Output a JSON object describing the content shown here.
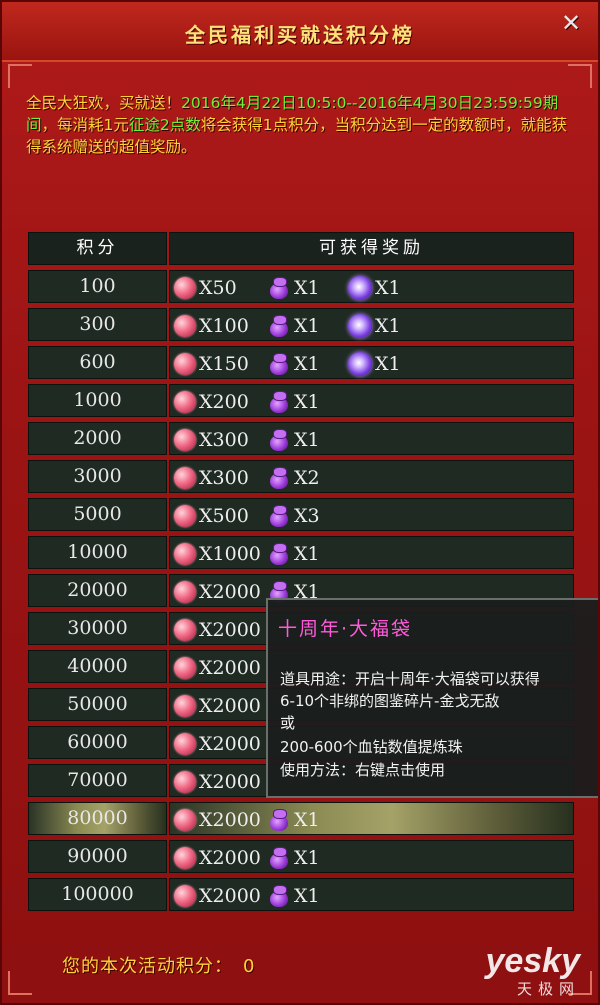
{
  "window": {
    "title": "全民福利买就送积分榜",
    "close_label": "✕"
  },
  "intro": {
    "part1": "全民大狂欢，买就送！",
    "period": "2016年4月22日10:5:0--2016年4月30日23:59:59期间",
    "part2": "，每消耗1元",
    "highlight": "征途2点数",
    "part3": "将会获得1点积分，当积分达到一定的数额时，就能获得系统赠送的超值奖励。"
  },
  "table": {
    "header_points": "积分",
    "header_rewards": "可获得奖励",
    "rows": [
      {
        "points": "100",
        "gem_qty": "X50",
        "bag_qty": "X1",
        "orb_qty": "X1"
      },
      {
        "points": "300",
        "gem_qty": "X100",
        "bag_qty": "X1",
        "orb_qty": "X1"
      },
      {
        "points": "600",
        "gem_qty": "X150",
        "bag_qty": "X1",
        "orb_qty": "X1"
      },
      {
        "points": "1000",
        "gem_qty": "X200",
        "bag_qty": "X1"
      },
      {
        "points": "2000",
        "gem_qty": "X300",
        "bag_qty": "X1"
      },
      {
        "points": "3000",
        "gem_qty": "X300",
        "bag_qty": "X2"
      },
      {
        "points": "5000",
        "gem_qty": "X500",
        "bag_qty": "X3"
      },
      {
        "points": "10000",
        "gem_qty": "X1000",
        "bag_qty": "X1"
      },
      {
        "points": "20000",
        "gem_qty": "X2000",
        "bag_qty": "X1"
      },
      {
        "points": "30000",
        "gem_qty": "X2000"
      },
      {
        "points": "40000",
        "gem_qty": "X2000"
      },
      {
        "points": "50000",
        "gem_qty": "X2000"
      },
      {
        "points": "60000",
        "gem_qty": "X2000"
      },
      {
        "points": "70000",
        "gem_qty": "X2000"
      },
      {
        "points": "80000",
        "gem_qty": "X2000",
        "bag_qty": "X1",
        "selected": true
      },
      {
        "points": "90000",
        "gem_qty": "X2000",
        "bag_qty": "X1"
      },
      {
        "points": "100000",
        "gem_qty": "X2000",
        "bag_qty": "X1"
      }
    ]
  },
  "tooltip": {
    "title": "十周年·大福袋",
    "line1": "道具用途：开启十周年·大福袋可以获得",
    "line2": "6-10个非绑的图鉴碎片-金戈无敌",
    "line3": "或",
    "line4": "200-600个血钻数值提炼珠",
    "line5": "使用方法：右键点击使用"
  },
  "footer": {
    "label": "您的本次活动积分：",
    "value": "0"
  },
  "watermark": {
    "brand": "yesky",
    "cn": "天极网"
  },
  "icons": {
    "gem": "red-gem-icon",
    "bag": "purple-bag-icon",
    "orb": "purple-orb-icon"
  }
}
